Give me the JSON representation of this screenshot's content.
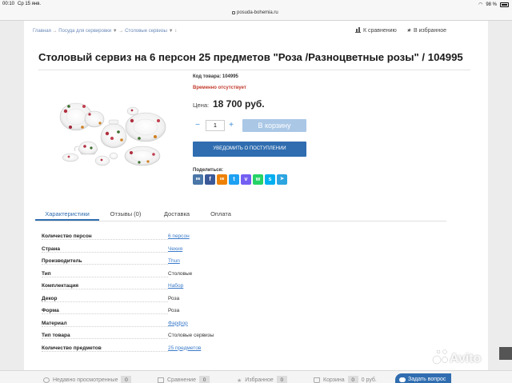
{
  "status_bar": {
    "time": "00:10",
    "date": "Ср 15 янв.",
    "battery": "98 %"
  },
  "browser": {
    "url": "posuda-bohemia.ru"
  },
  "breadcrumb": {
    "items": [
      "Главная",
      "Посуда для сервировки",
      "Столовые сервизы"
    ],
    "separator": "→",
    "dropdown_glyph": "▼",
    "trailing_glyph": "↕"
  },
  "actions": {
    "compare_label": "К сравнению",
    "favorites_label": "В избранное"
  },
  "product": {
    "title": "Столовый сервиз на 6 персон 25 предметов \"Роза /Разноцветные розы\" / 104995",
    "code_label": "Код товара:",
    "code": "104995",
    "availability": "Временно отсутствует",
    "price_label": "Цена:",
    "price": "18 700 руб.",
    "quantity": "1",
    "minus": "−",
    "plus": "+",
    "cart_button": "В корзину",
    "notify_button": "УВЕДОМИТЬ О ПОСТУПЛЕНИИ",
    "share_label": "Поделиться:",
    "share_icons": [
      {
        "name": "vk-icon",
        "glyph": "вк",
        "color": "#4a76a8"
      },
      {
        "name": "facebook-icon",
        "glyph": "f",
        "color": "#3b5998"
      },
      {
        "name": "odnoklassniki-icon",
        "glyph": "ок",
        "color": "#ee8208"
      },
      {
        "name": "twitter-icon",
        "glyph": "t",
        "color": "#1da1f2"
      },
      {
        "name": "viber-icon",
        "glyph": "v",
        "color": "#7360f2"
      },
      {
        "name": "whatsapp-icon",
        "glyph": "w",
        "color": "#25d366"
      },
      {
        "name": "skype-icon",
        "glyph": "s",
        "color": "#00aff0"
      },
      {
        "name": "telegram-icon",
        "glyph": "➤",
        "color": "#2ca5e0"
      }
    ]
  },
  "tabs": [
    {
      "label": "Характеристики",
      "active": true
    },
    {
      "label": "Отзывы (0)",
      "active": false
    },
    {
      "label": "Доставка",
      "active": false
    },
    {
      "label": "Оплата",
      "active": false
    }
  ],
  "specs": [
    {
      "label": "Количество персон",
      "value": "6 персон",
      "link": true
    },
    {
      "label": "Страна",
      "value": "Чехия",
      "link": true
    },
    {
      "label": "Производитель",
      "value": "Thun",
      "link": true
    },
    {
      "label": "Тип",
      "value": "Столовые",
      "link": false
    },
    {
      "label": "Комплектация",
      "value": "Набор",
      "link": true
    },
    {
      "label": "Декор",
      "value": "Роза",
      "link": false
    },
    {
      "label": "Форма",
      "value": "Роза",
      "link": false
    },
    {
      "label": "Материал",
      "value": "Фарфор",
      "link": true
    },
    {
      "label": "Тип товара",
      "value": "Столовые сервизы",
      "link": false
    },
    {
      "label": "Количество предметов",
      "value": "25 предметов",
      "link": true
    }
  ],
  "bottom_bar": {
    "recent_label": "Недавно просмотренные",
    "recent_count": "0",
    "compare_label": "Сравнение",
    "compare_count": "0",
    "favorites_label": "Избранное",
    "favorites_count": "0",
    "cart_label": "Корзина",
    "cart_count": "0",
    "cart_total": "0 руб.",
    "ask_button": "Задать вопрос"
  },
  "watermark": {
    "text": "Avito"
  },
  "colors": {
    "accent": "#2f6db0",
    "link": "#3b7bc9",
    "unavailable": "#c0392b",
    "cart_button": "#aac7e6"
  }
}
